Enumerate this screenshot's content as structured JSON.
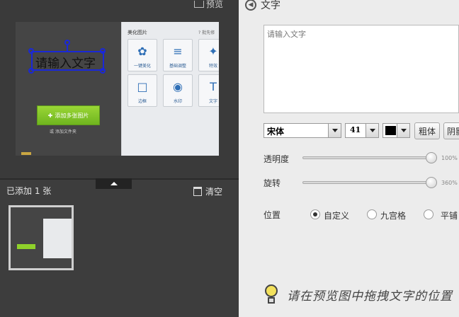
{
  "preview": {
    "label": "预览",
    "canvas_text": "请输入文字",
    "add_button": "添加多张图片",
    "add_folder": "或 添加文件夹",
    "tools_title": "美化图片",
    "tools_help": "批先修",
    "tools": [
      {
        "label": "一键美化",
        "icon": "flower-icon",
        "glyph": "✿"
      },
      {
        "label": "基础调整",
        "icon": "sliders-icon",
        "glyph": "≡"
      },
      {
        "label": "特效",
        "icon": "magic-wand-icon",
        "glyph": "✦"
      },
      {
        "label": "边框",
        "icon": "frame-icon",
        "glyph": "□"
      },
      {
        "label": "水印",
        "icon": "watermark-icon",
        "glyph": "◉"
      },
      {
        "label": "文字",
        "icon": "text-icon",
        "glyph": "T"
      }
    ]
  },
  "footer_left": {
    "added_label": "已添加 1 张",
    "clear_label": "清空"
  },
  "panel": {
    "title": "文字",
    "text_placeholder": "请输入文字",
    "font": "宋体",
    "font_size": "41",
    "text_color": "#000000",
    "bold_label": "粗体",
    "shadow_label": "阴影",
    "opacity_label": "透明度",
    "opacity_value": "100%",
    "opacity_fraction": 1.0,
    "rotate_label": "旋转",
    "rotate_value": "360%",
    "rotate_fraction": 1.0,
    "position_label": "位置",
    "position_options": [
      "自定义",
      "九宫格",
      "平铺"
    ],
    "position_selected": 0,
    "tip": "请在预览图中拖拽文字的位置"
  },
  "colors": {
    "accent_blue": "#1a28d8",
    "button_green": "#7dc322"
  }
}
